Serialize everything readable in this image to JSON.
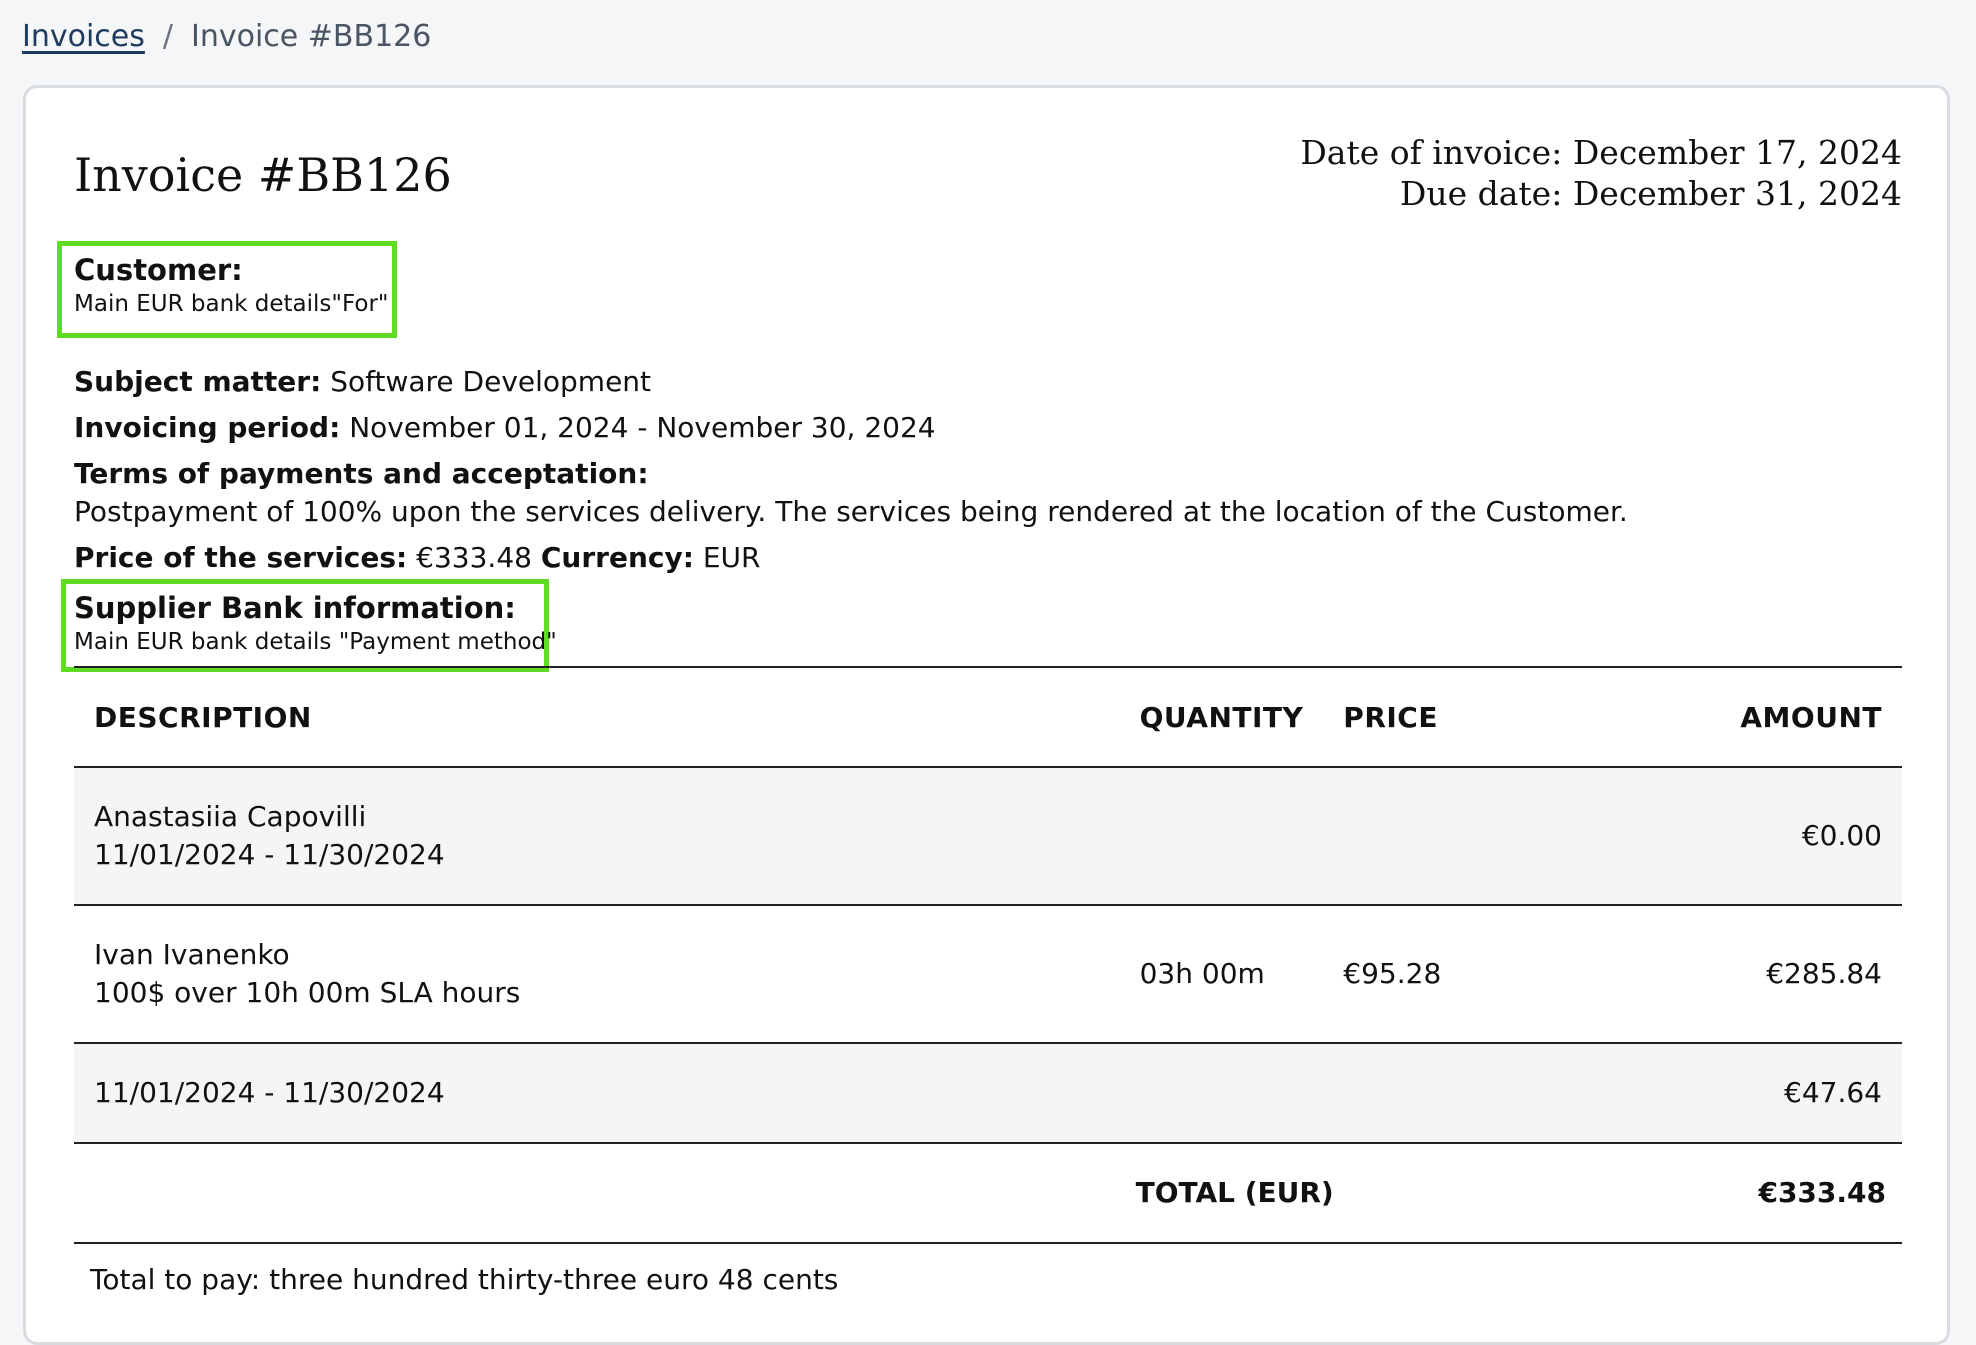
{
  "breadcrumb": {
    "parent": "Invoices",
    "separator": "/",
    "current": "Invoice #BB126"
  },
  "invoice": {
    "title": "Invoice #BB126",
    "date_label": "Date of invoice:",
    "date_value": "December 17, 2024",
    "due_label": "Due date:",
    "due_value": "December 31, 2024"
  },
  "customer": {
    "label": "Customer:",
    "value": "Main EUR bank details\"For\""
  },
  "details": {
    "subject_label": "Subject matter:",
    "subject_value": "Software Development",
    "period_label": "Invoicing period:",
    "period_value": "November 01, 2024 - November 30, 2024",
    "terms_label": "Terms of payments and acceptation:",
    "terms_value": "Postpayment of 100% upon the services delivery. The services being rendered at the location of the Customer.",
    "price_label": "Price of the services:",
    "price_value": "€333.48",
    "currency_label": "Currency:",
    "currency_value": "EUR"
  },
  "bank": {
    "label": "Supplier Bank information:",
    "value": "Main EUR bank details \"Payment method\""
  },
  "table": {
    "headers": {
      "description": "DESCRIPTION",
      "quantity": "QUANTITY",
      "price": "PRICE",
      "amount": "AMOUNT"
    },
    "rows": [
      {
        "line1": "Anastasiia Capovilli",
        "line2": "11/01/2024 - 11/30/2024",
        "quantity": "",
        "price": "",
        "amount": "€0.00"
      },
      {
        "line1": "Ivan Ivanenko",
        "line2": "100$ over 10h 00m SLA hours",
        "quantity": "03h 00m",
        "price": "€95.28",
        "amount": "€285.84"
      },
      {
        "line1": "11/01/2024 - 11/30/2024",
        "line2": "",
        "quantity": "",
        "price": "",
        "amount": "€47.64"
      }
    ],
    "total_label": "TOTAL (EUR)",
    "total_value": "€333.48"
  },
  "total_words": "Total to pay: three hundred thirty-three euro 48 cents"
}
